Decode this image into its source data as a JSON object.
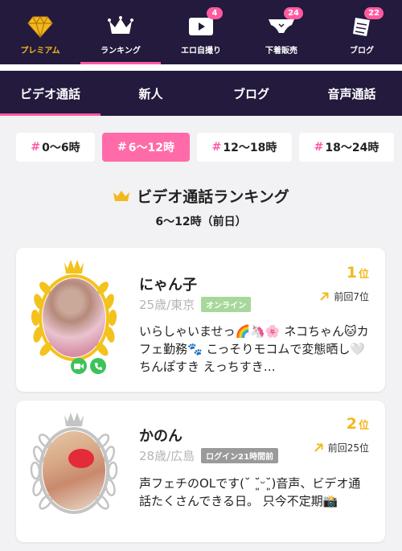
{
  "topnav": [
    {
      "label": "プレミアム",
      "icon": "diamond-icon",
      "badge": ""
    },
    {
      "label": "ランキング",
      "icon": "crown-icon",
      "badge": ""
    },
    {
      "label": "エロ自撮り",
      "icon": "video-play-icon",
      "badge": "4"
    },
    {
      "label": "下着販売",
      "icon": "lingerie-icon",
      "badge": "24"
    },
    {
      "label": "ブログ",
      "icon": "notebook-icon",
      "badge": "22"
    }
  ],
  "subtabs": [
    "ビデオ通話",
    "新人",
    "ブログ",
    "音声通話"
  ],
  "time_filters": [
    "0〜6時",
    "6〜12時",
    "12〜18時",
    "18〜24時"
  ],
  "time_filter_prefix": "#",
  "heading": {
    "title": "ビデオ通話ランキング",
    "subtitle": "6〜12時（前日）"
  },
  "rankings": [
    {
      "rank_num": "1",
      "rank_unit": "位",
      "prev_rank": "前回7位",
      "name": "にゃん子",
      "age_area": "25歳/東京",
      "status": "オンライン",
      "bio": "いらしゃいませっ🌈🦄🌸 ネコちゃん🐱カフェ勤務🐾 こっそりモコムで変態晒し🤍 ちんぽすき えっちすき…"
    },
    {
      "rank_num": "2",
      "rank_unit": "位",
      "prev_rank": "前回25位",
      "name": "かのん",
      "age_area": "28歳/広島",
      "status": "ログイン21時間前",
      "bio": "声フェチのOLです(˘ ˘͈ᵕ˘͈)音声、ビデオ通話たくさんできる日。 只今不定期📸"
    }
  ],
  "colors": {
    "nav_bg": "#231a3d",
    "accent_pink": "#ff5aa0",
    "gold": "#f3b81c",
    "online_green": "#a7d89a",
    "offline_gray": "#9a9a9a",
    "call_green": "#3cc35a"
  }
}
